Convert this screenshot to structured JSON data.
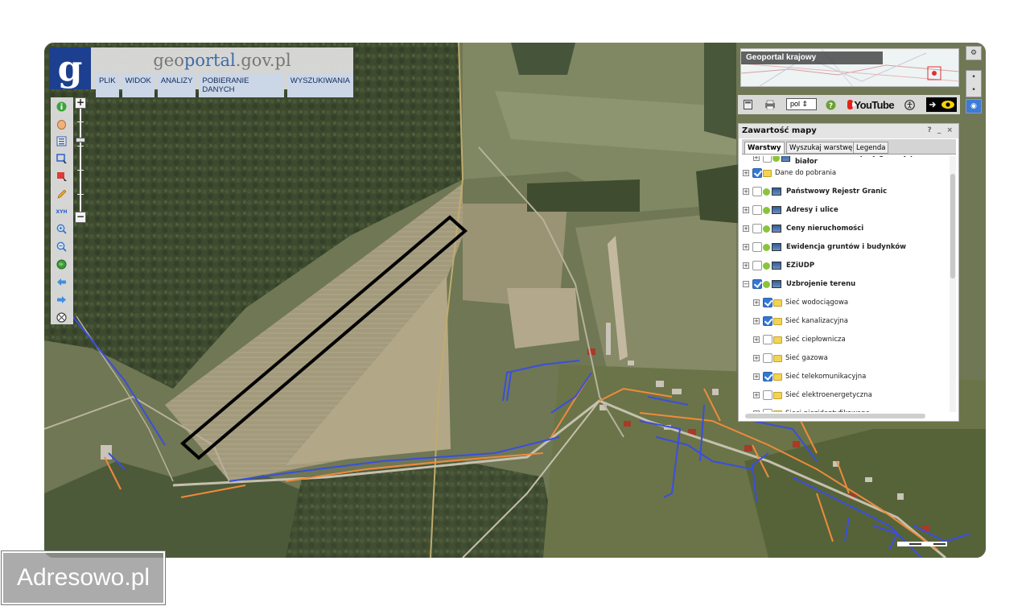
{
  "header": {
    "logo_letter": "g",
    "site_title_g": "g",
    "site_title_rest1": "eo",
    "site_title_portal": "portal",
    "site_title_domain": ".gov.pl",
    "menu": [
      "PLIK",
      "WIDOK",
      "ANALIZY",
      "POBIERANIE DANYCH",
      "WYSZUKIWANIA"
    ]
  },
  "toolbar": {
    "tools": [
      "info-icon",
      "pan-hand-icon",
      "legend-icon",
      "select-area-icon",
      "clear-selection-icon",
      "draw-pencil-icon",
      "xyh-icon",
      "zoom-in-icon",
      "zoom-out-icon",
      "full-extent-globe-icon",
      "back-arrow-icon",
      "forward-arrow-icon",
      "reset-icon"
    ],
    "xyh_label": "XYH",
    "zoom_in": "+",
    "zoom_out": "−"
  },
  "overview": {
    "label": "Geoportal krajowy"
  },
  "iconbar": {
    "lang": "pol",
    "youtube": "YouTube"
  },
  "panel": {
    "title": "Zawartość mapy",
    "controls": "? _ ×",
    "tabs": [
      "Warstwy",
      "Wyszukaj warstwę",
      "Legenda"
    ],
    "active_tab": 0,
    "layers": [
      {
        "name": "Strefa buforowa przy granicy polsko-białor",
        "level": 1,
        "checked": false,
        "icon": "wms",
        "bold": true,
        "partial": true
      },
      {
        "name": "Dane do pobrania",
        "level": 0,
        "checked": true,
        "icon": "folder",
        "bold": false
      },
      {
        "name": "Państwowy Rejestr Granic",
        "level": 0,
        "checked": false,
        "icon": "wms",
        "bold": true
      },
      {
        "name": "Adresy i ulice",
        "level": 0,
        "checked": false,
        "icon": "wms",
        "bold": true
      },
      {
        "name": "Ceny nieruchomości",
        "level": 0,
        "checked": false,
        "icon": "wms",
        "bold": true
      },
      {
        "name": "Ewidencja gruntów i budynków",
        "level": 0,
        "checked": false,
        "icon": "wms",
        "bold": true
      },
      {
        "name": "EZiUDP",
        "level": 0,
        "checked": false,
        "icon": "wms",
        "bold": true
      },
      {
        "name": "Uzbrojenie terenu",
        "level": 0,
        "checked": true,
        "icon": "wms",
        "bold": true,
        "expanded": true
      },
      {
        "name": "Sieć wodociągowa",
        "level": 1,
        "checked": true,
        "icon": "folder",
        "bold": false
      },
      {
        "name": "Sieć kanalizacyjna",
        "level": 1,
        "checked": true,
        "icon": "folder",
        "bold": false
      },
      {
        "name": "Sieć ciepłownicza",
        "level": 1,
        "checked": false,
        "icon": "folder",
        "bold": false
      },
      {
        "name": "Sieć gazowa",
        "level": 1,
        "checked": false,
        "icon": "folder",
        "bold": false
      },
      {
        "name": "Sieć telekomunikacyjna",
        "level": 1,
        "checked": true,
        "icon": "folder",
        "bold": false
      },
      {
        "name": "Sieć elektroenergetyczna",
        "level": 1,
        "checked": false,
        "icon": "folder",
        "bold": false
      },
      {
        "name": "Sieci niezidentyfikowane",
        "level": 1,
        "checked": false,
        "icon": "folder",
        "bold": false
      }
    ]
  },
  "colors": {
    "water_network": "#3a4ee0",
    "power_network": "#f08a3c",
    "boundary_outline": "#000000",
    "logo_blue": "#1d3f8f"
  },
  "watermark": "Adresowo.pl"
}
